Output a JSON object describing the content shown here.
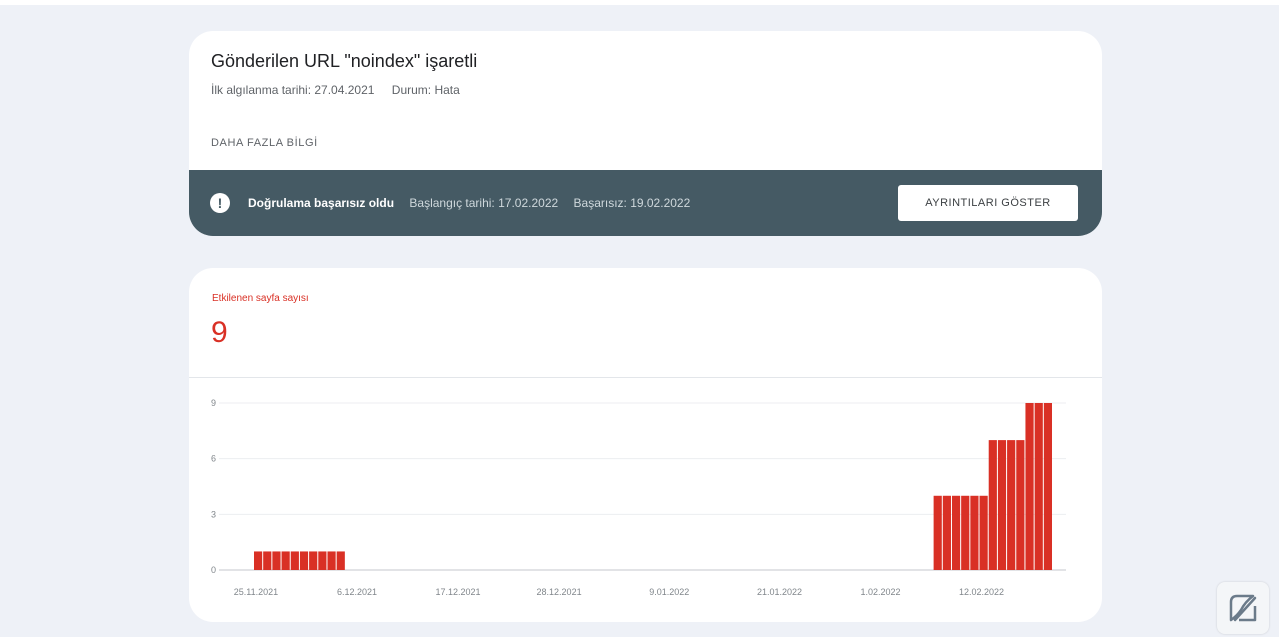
{
  "issue": {
    "title": "Gönderilen URL \"noindex\" işaretli",
    "first_detected": "İlk algılanma tarihi: 27.04.2021",
    "status": "Durum: Hata",
    "more_info": "DAHA FAZLA BİLGİ"
  },
  "validation": {
    "status_label": "Doğrulama başarısız oldu",
    "start_date": "Başlangıç tarihi: 17.02.2022",
    "failed_date": "Başarısız: 19.02.2022",
    "details_button": "AYRINTILARI GÖSTER",
    "icon": "exclamation-icon"
  },
  "metric": {
    "label": "Etkilenen sayfa sayısı",
    "value": "9",
    "color": "#d93025"
  },
  "chart_data": {
    "type": "bar",
    "color": "#d93025",
    "x_start": "25.11.2021",
    "x_end": "23.02.2022",
    "x_tick_labels": [
      "25.11.2021",
      "6.12.2021",
      "17.12.2021",
      "28.12.2021",
      "9.01.2022",
      "21.01.2022",
      "1.02.2022",
      "12.02.2022"
    ],
    "ylim": [
      0,
      9
    ],
    "y_ticks": [
      0,
      3,
      6,
      9
    ],
    "grid": true,
    "series": [
      {
        "values": [
          1,
          1,
          1,
          1,
          1,
          1,
          1,
          1,
          1,
          1,
          0,
          0,
          0,
          0,
          0,
          0,
          0,
          0,
          0,
          0,
          0,
          0,
          0,
          0,
          0,
          0,
          0,
          0,
          0,
          0,
          0,
          0,
          0,
          0,
          0,
          0,
          0,
          0,
          0,
          0,
          0,
          0,
          0,
          0,
          0,
          0,
          0,
          0,
          0,
          0,
          0,
          0,
          0,
          0,
          0,
          0,
          0,
          0,
          0,
          0,
          0,
          0,
          0,
          0,
          0,
          0,
          0,
          0,
          0,
          0,
          0,
          0,
          0,
          0,
          4,
          4,
          4,
          4,
          4,
          4,
          7,
          7,
          7,
          7,
          9,
          9,
          9
        ]
      }
    ]
  }
}
